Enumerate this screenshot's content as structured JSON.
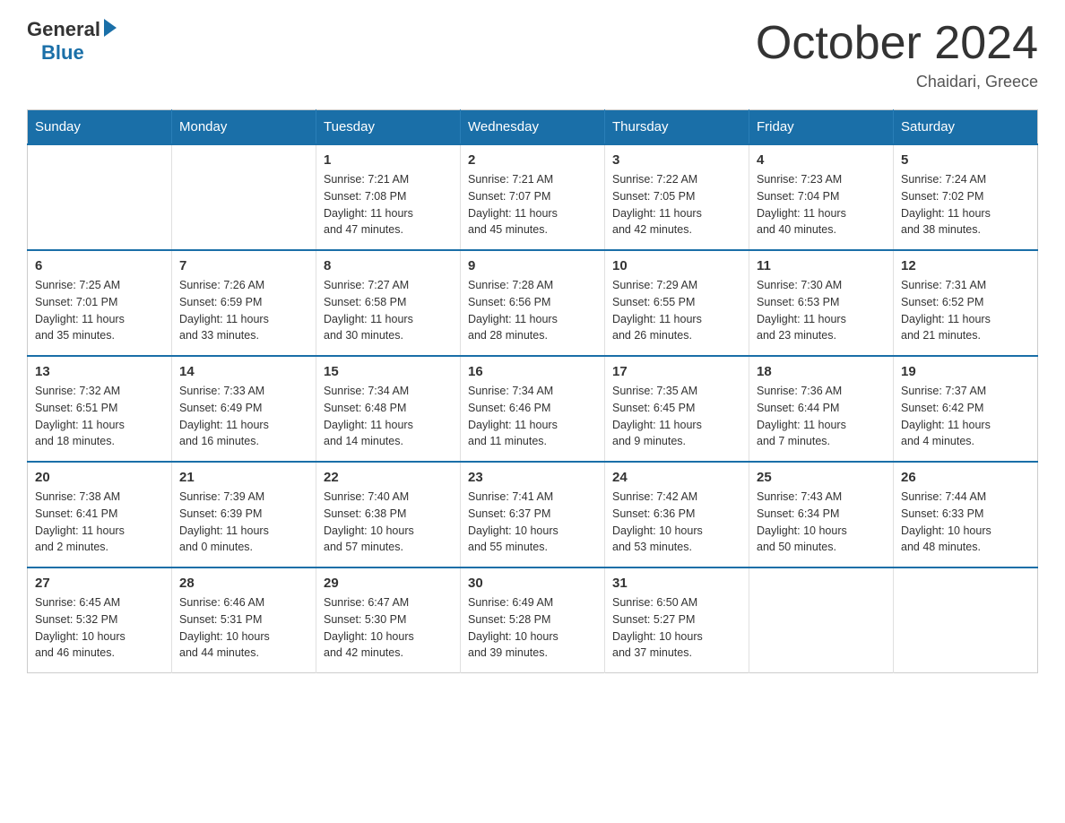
{
  "logo": {
    "general": "General",
    "blue": "Blue"
  },
  "title": "October 2024",
  "location": "Chaidari, Greece",
  "days_of_week": [
    "Sunday",
    "Monday",
    "Tuesday",
    "Wednesday",
    "Thursday",
    "Friday",
    "Saturday"
  ],
  "weeks": [
    [
      {
        "day": "",
        "info": ""
      },
      {
        "day": "",
        "info": ""
      },
      {
        "day": "1",
        "info": "Sunrise: 7:21 AM\nSunset: 7:08 PM\nDaylight: 11 hours\nand 47 minutes."
      },
      {
        "day": "2",
        "info": "Sunrise: 7:21 AM\nSunset: 7:07 PM\nDaylight: 11 hours\nand 45 minutes."
      },
      {
        "day": "3",
        "info": "Sunrise: 7:22 AM\nSunset: 7:05 PM\nDaylight: 11 hours\nand 42 minutes."
      },
      {
        "day": "4",
        "info": "Sunrise: 7:23 AM\nSunset: 7:04 PM\nDaylight: 11 hours\nand 40 minutes."
      },
      {
        "day": "5",
        "info": "Sunrise: 7:24 AM\nSunset: 7:02 PM\nDaylight: 11 hours\nand 38 minutes."
      }
    ],
    [
      {
        "day": "6",
        "info": "Sunrise: 7:25 AM\nSunset: 7:01 PM\nDaylight: 11 hours\nand 35 minutes."
      },
      {
        "day": "7",
        "info": "Sunrise: 7:26 AM\nSunset: 6:59 PM\nDaylight: 11 hours\nand 33 minutes."
      },
      {
        "day": "8",
        "info": "Sunrise: 7:27 AM\nSunset: 6:58 PM\nDaylight: 11 hours\nand 30 minutes."
      },
      {
        "day": "9",
        "info": "Sunrise: 7:28 AM\nSunset: 6:56 PM\nDaylight: 11 hours\nand 28 minutes."
      },
      {
        "day": "10",
        "info": "Sunrise: 7:29 AM\nSunset: 6:55 PM\nDaylight: 11 hours\nand 26 minutes."
      },
      {
        "day": "11",
        "info": "Sunrise: 7:30 AM\nSunset: 6:53 PM\nDaylight: 11 hours\nand 23 minutes."
      },
      {
        "day": "12",
        "info": "Sunrise: 7:31 AM\nSunset: 6:52 PM\nDaylight: 11 hours\nand 21 minutes."
      }
    ],
    [
      {
        "day": "13",
        "info": "Sunrise: 7:32 AM\nSunset: 6:51 PM\nDaylight: 11 hours\nand 18 minutes."
      },
      {
        "day": "14",
        "info": "Sunrise: 7:33 AM\nSunset: 6:49 PM\nDaylight: 11 hours\nand 16 minutes."
      },
      {
        "day": "15",
        "info": "Sunrise: 7:34 AM\nSunset: 6:48 PM\nDaylight: 11 hours\nand 14 minutes."
      },
      {
        "day": "16",
        "info": "Sunrise: 7:34 AM\nSunset: 6:46 PM\nDaylight: 11 hours\nand 11 minutes."
      },
      {
        "day": "17",
        "info": "Sunrise: 7:35 AM\nSunset: 6:45 PM\nDaylight: 11 hours\nand 9 minutes."
      },
      {
        "day": "18",
        "info": "Sunrise: 7:36 AM\nSunset: 6:44 PM\nDaylight: 11 hours\nand 7 minutes."
      },
      {
        "day": "19",
        "info": "Sunrise: 7:37 AM\nSunset: 6:42 PM\nDaylight: 11 hours\nand 4 minutes."
      }
    ],
    [
      {
        "day": "20",
        "info": "Sunrise: 7:38 AM\nSunset: 6:41 PM\nDaylight: 11 hours\nand 2 minutes."
      },
      {
        "day": "21",
        "info": "Sunrise: 7:39 AM\nSunset: 6:39 PM\nDaylight: 11 hours\nand 0 minutes."
      },
      {
        "day": "22",
        "info": "Sunrise: 7:40 AM\nSunset: 6:38 PM\nDaylight: 10 hours\nand 57 minutes."
      },
      {
        "day": "23",
        "info": "Sunrise: 7:41 AM\nSunset: 6:37 PM\nDaylight: 10 hours\nand 55 minutes."
      },
      {
        "day": "24",
        "info": "Sunrise: 7:42 AM\nSunset: 6:36 PM\nDaylight: 10 hours\nand 53 minutes."
      },
      {
        "day": "25",
        "info": "Sunrise: 7:43 AM\nSunset: 6:34 PM\nDaylight: 10 hours\nand 50 minutes."
      },
      {
        "day": "26",
        "info": "Sunrise: 7:44 AM\nSunset: 6:33 PM\nDaylight: 10 hours\nand 48 minutes."
      }
    ],
    [
      {
        "day": "27",
        "info": "Sunrise: 6:45 AM\nSunset: 5:32 PM\nDaylight: 10 hours\nand 46 minutes."
      },
      {
        "day": "28",
        "info": "Sunrise: 6:46 AM\nSunset: 5:31 PM\nDaylight: 10 hours\nand 44 minutes."
      },
      {
        "day": "29",
        "info": "Sunrise: 6:47 AM\nSunset: 5:30 PM\nDaylight: 10 hours\nand 42 minutes."
      },
      {
        "day": "30",
        "info": "Sunrise: 6:49 AM\nSunset: 5:28 PM\nDaylight: 10 hours\nand 39 minutes."
      },
      {
        "day": "31",
        "info": "Sunrise: 6:50 AM\nSunset: 5:27 PM\nDaylight: 10 hours\nand 37 minutes."
      },
      {
        "day": "",
        "info": ""
      },
      {
        "day": "",
        "info": ""
      }
    ]
  ]
}
